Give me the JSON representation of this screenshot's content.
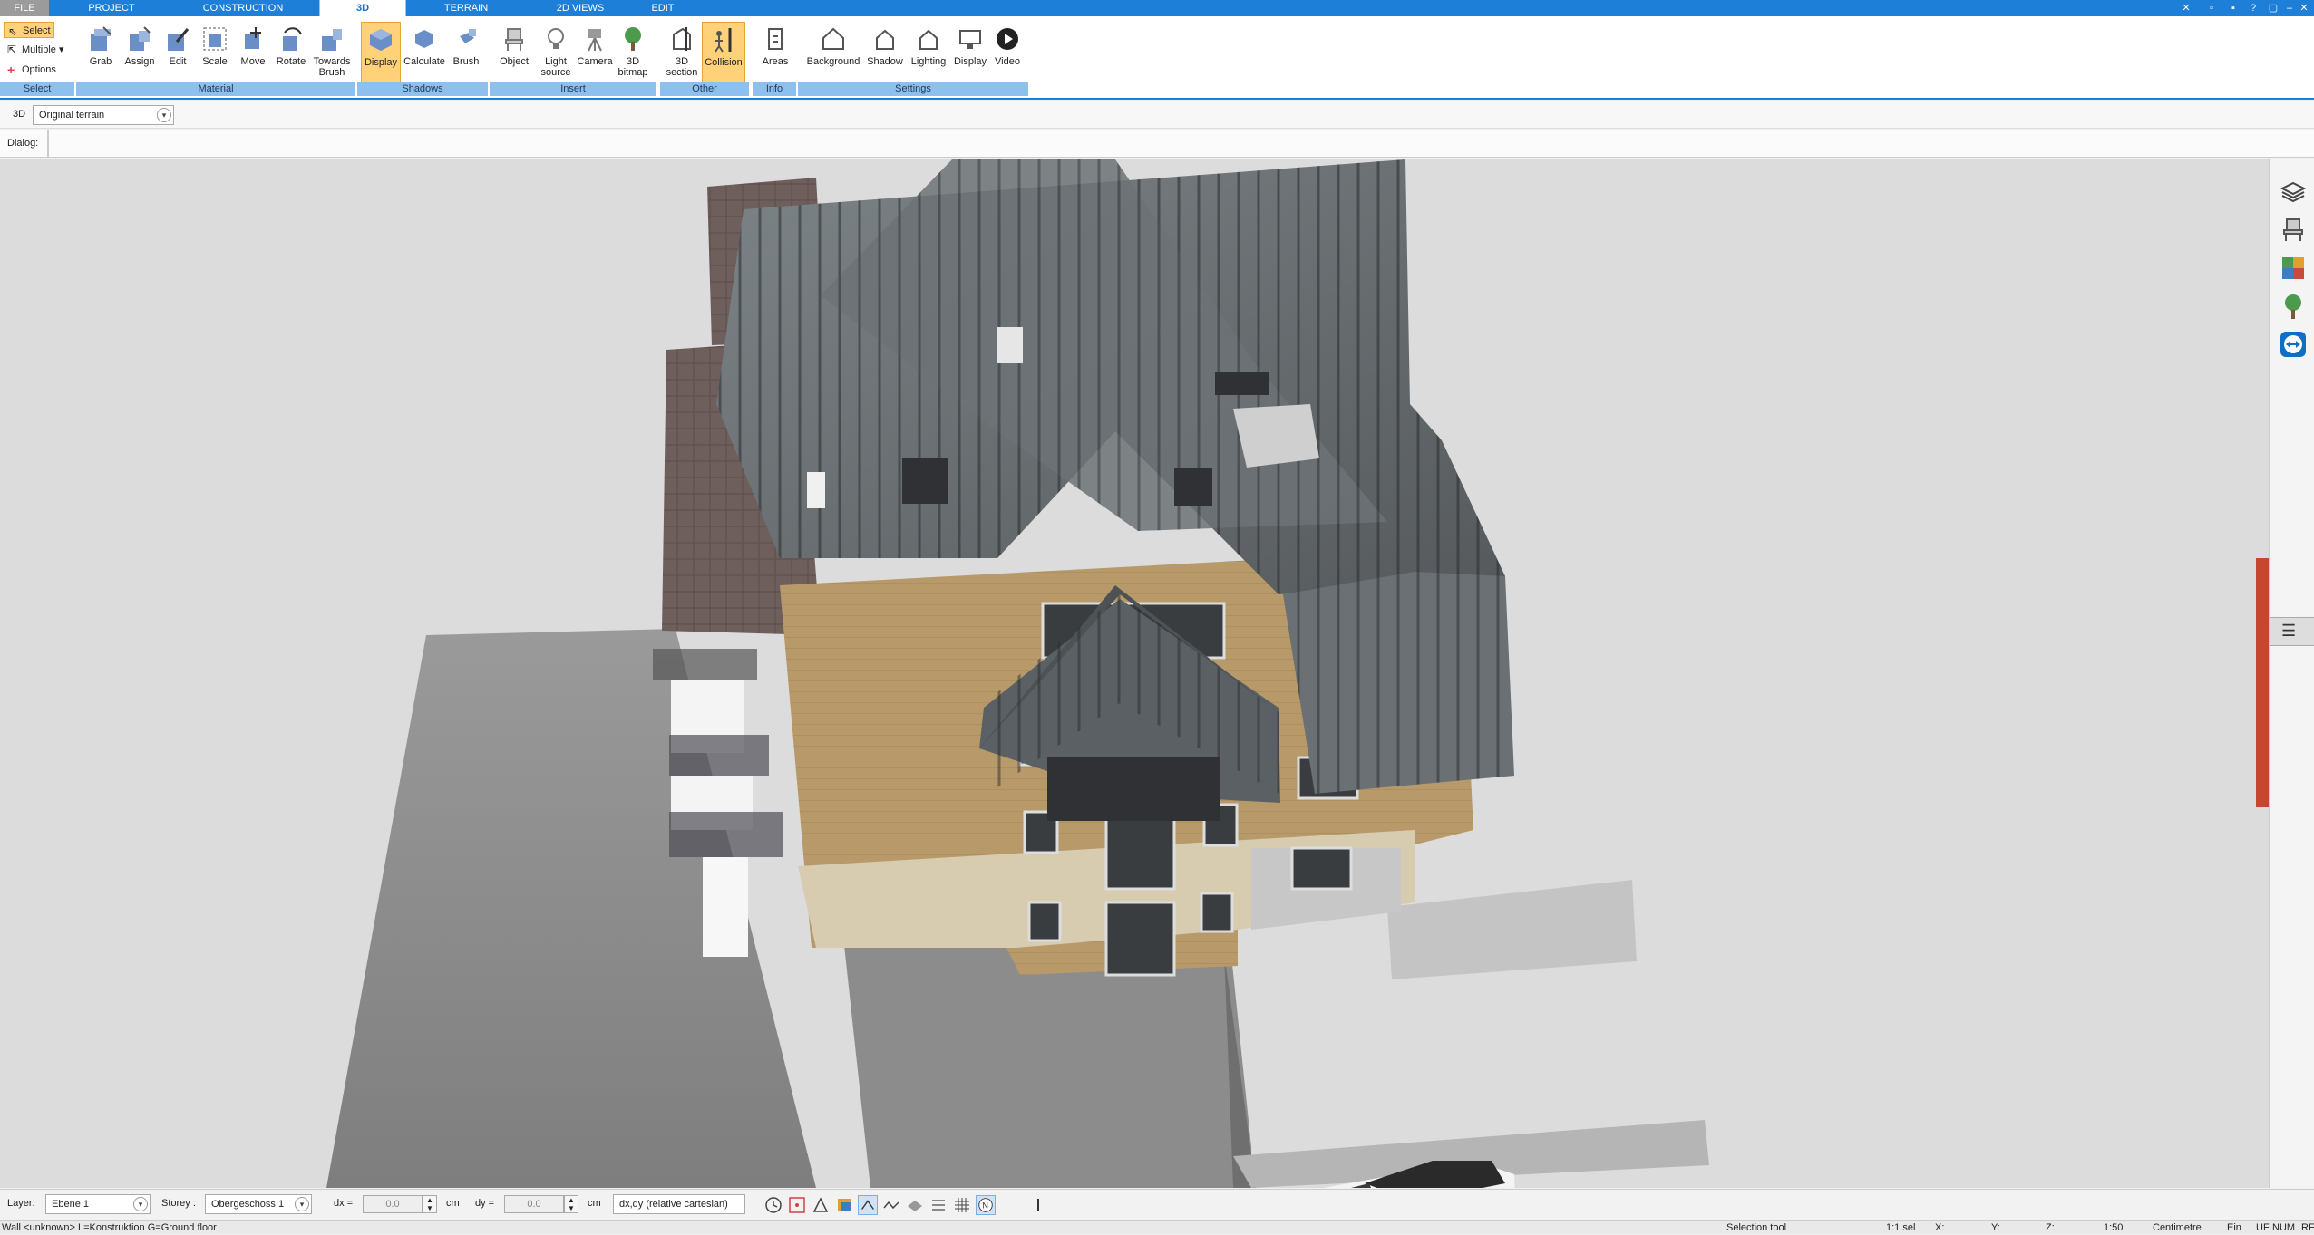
{
  "tabs": [
    {
      "label": "FILE"
    },
    {
      "label": "PROJECT"
    },
    {
      "label": "CONSTRUCTION"
    },
    {
      "label": "3D"
    },
    {
      "label": "TERRAIN"
    },
    {
      "label": "2D VIEWS"
    },
    {
      "label": "EDIT"
    }
  ],
  "select_group": {
    "select": "Select",
    "multiple": "Multiple",
    "options": "Options",
    "label": "Select"
  },
  "ribbon": {
    "material": {
      "label": "Material",
      "buttons": [
        "Grab",
        "Assign",
        "Edit",
        "Scale",
        "Move",
        "Rotate",
        "Towards Brush"
      ]
    },
    "shadows": {
      "label": "Shadows",
      "buttons": [
        "Display",
        "Calculate",
        "Brush"
      ]
    },
    "insert": {
      "label": "Insert",
      "buttons": [
        "Object",
        "Light source",
        "Camera",
        "3D bitmap"
      ]
    },
    "other": {
      "label": "Other",
      "buttons": [
        "3D section",
        "Collision"
      ]
    },
    "info": {
      "label": "Info",
      "buttons": [
        "Areas"
      ]
    },
    "settings": {
      "label": "Settings",
      "buttons": [
        "Background",
        "Shadow",
        "Lighting",
        "Display",
        "Video"
      ]
    }
  },
  "row2": {
    "mode": "3D",
    "terrain_select": "Original terrain"
  },
  "row3": {
    "dialog_label": "Dialog:"
  },
  "bottom": {
    "layer_label": "Layer:",
    "layer_value": "Ebene 1",
    "storey_label": "Storey :",
    "storey_value": "Obergeschoss 1",
    "dx_label": "dx =",
    "dx_value": "0.0",
    "dx_unit": "cm",
    "dy_label": "dy =",
    "dy_value": "0.0",
    "dy_unit": "cm",
    "coord_mode": "dx,dy (relative cartesian)"
  },
  "status": {
    "message": "Wall <unknown> L=Konstruktion G=Ground floor",
    "tool": "Selection tool",
    "scale_sel": "1:1 sel",
    "x": "X:",
    "y": "Y:",
    "z": "Z:",
    "scale": "1:50",
    "unit": "Centimetre",
    "ein": "Ein",
    "uf": "UF",
    "num": "NUM",
    "rf": "RF"
  },
  "colors": {
    "accent": "#1e7fd8",
    "highlight": "#ffd27a",
    "group_bar": "#8ec0ef"
  }
}
